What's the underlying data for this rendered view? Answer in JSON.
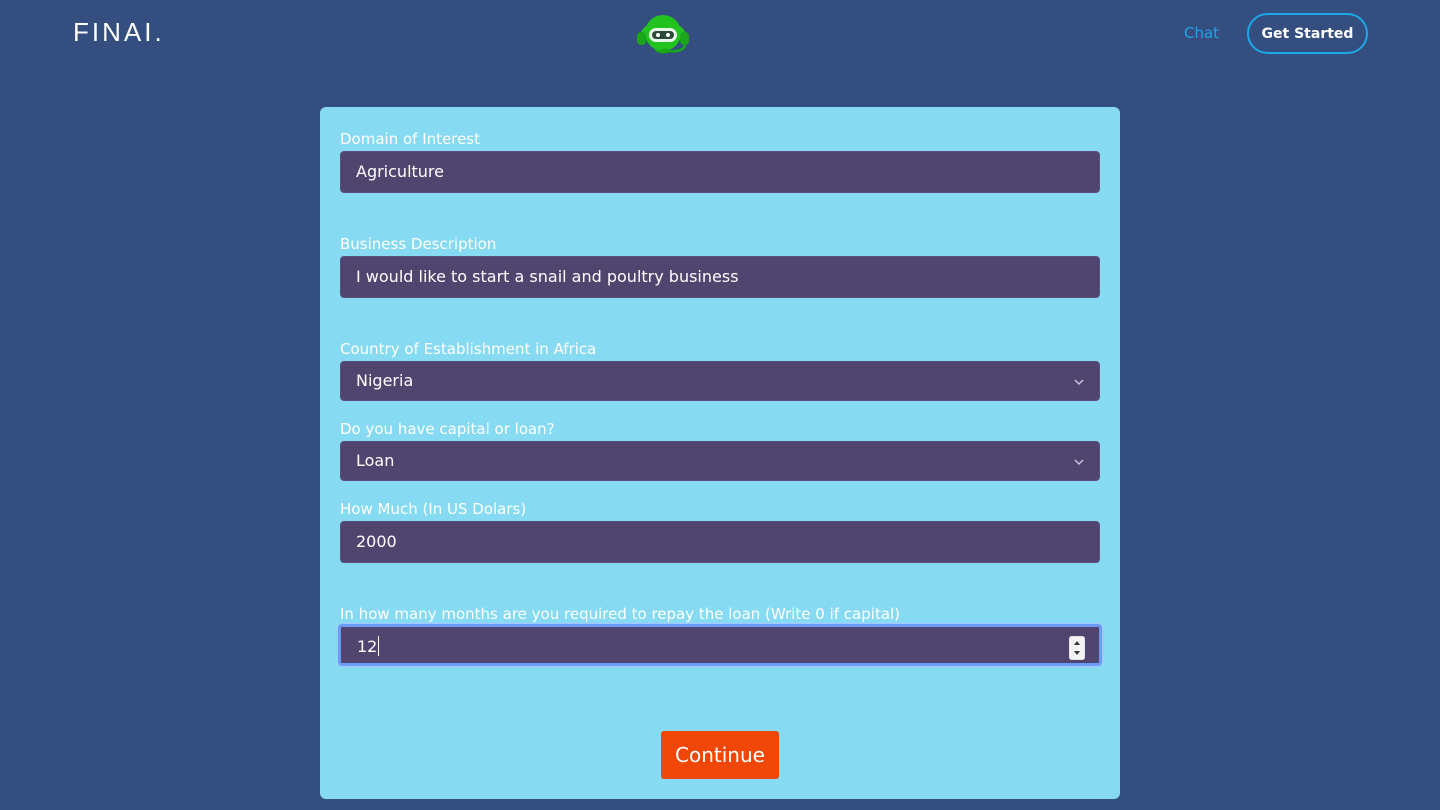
{
  "header": {
    "logo_text": "FINAI.",
    "bot_icon": "chatbot-headset-icon",
    "nav_chat": "Chat",
    "get_started": "Get Started"
  },
  "form": {
    "domain": {
      "label": "Domain of Interest",
      "value": "Agriculture"
    },
    "business": {
      "label": "Business Description",
      "value": "I would like to start a snail and poultry business"
    },
    "country": {
      "label": "Country of Establishment in Africa",
      "selected": "Nigeria"
    },
    "funding": {
      "label": "Do you have capital or loan?",
      "selected": "Loan"
    },
    "amount": {
      "label": "How Much (In US Dolars)",
      "value": "2000"
    },
    "months": {
      "label": "In how many months are you required to repay the loan (Write 0 if capital)",
      "value": "12"
    },
    "continue_label": "Continue"
  },
  "colors": {
    "page_bg": "#344e80",
    "card_bg": "#86daf2",
    "field_bg": "#50456f",
    "accent": "#1fa6e6",
    "button": "#f04709",
    "bot_green": "#22c21f"
  }
}
